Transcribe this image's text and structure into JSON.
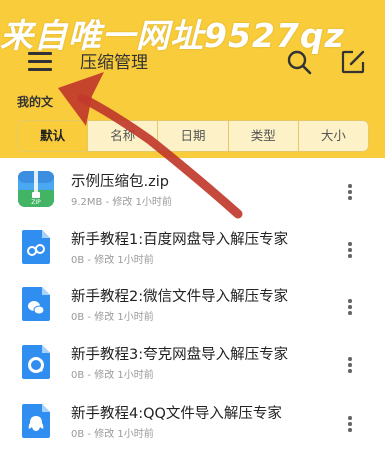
{
  "watermark": "来自唯一网址9527qz",
  "header": {
    "title": "压缩管理",
    "bg_color": "#f9cc3b"
  },
  "section": {
    "label": "我的文"
  },
  "sort_tabs": [
    {
      "label": "默认",
      "active": true
    },
    {
      "label": "名称",
      "active": false
    },
    {
      "label": "日期",
      "active": false
    },
    {
      "label": "类型",
      "active": false
    },
    {
      "label": "大小",
      "active": false
    }
  ],
  "files": [
    {
      "name": "示例压缩包.zip",
      "meta": "9.2MB - 修改 1小时前",
      "icon": "zip-file-icon"
    },
    {
      "name": "新手教程1:百度网盘导入解压专家",
      "meta": "0B - 修改 1小时前",
      "icon": "baidu-netdisk-file-icon"
    },
    {
      "name": "新手教程2:微信文件导入解压专家",
      "meta": "0B - 修改 1小时前",
      "icon": "wechat-file-icon"
    },
    {
      "name": "新手教程3:夸克网盘导入解压专家",
      "meta": "0B - 修改 1小时前",
      "icon": "quark-file-icon"
    },
    {
      "name": "新手教程4:QQ文件导入解压专家",
      "meta": "0B - 修改 1小时前",
      "icon": "qq-file-icon"
    }
  ],
  "annotation": {
    "color": "#c0392b",
    "icon": "red-arrow-annotation"
  }
}
